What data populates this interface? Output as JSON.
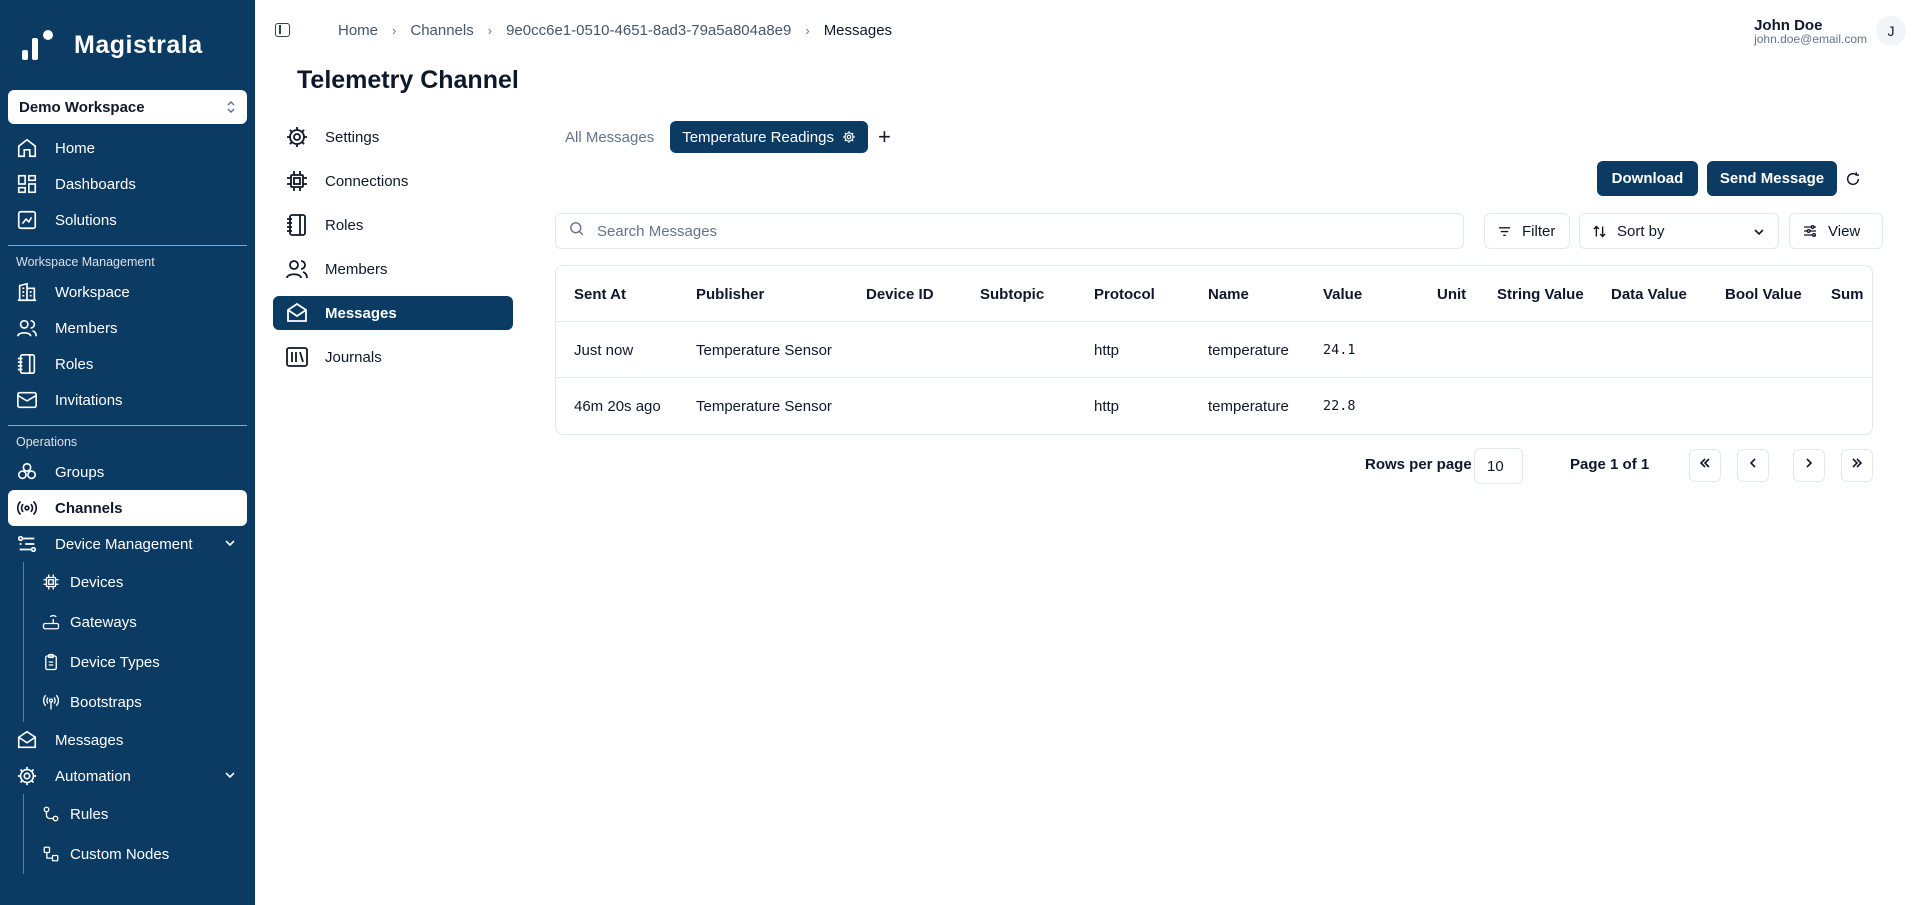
{
  "app": {
    "name": "Magistrala"
  },
  "workspace": {
    "selected": "Demo Workspace"
  },
  "sidebar": {
    "main": [
      {
        "label": "Home",
        "icon": "home-icon"
      },
      {
        "label": "Dashboards",
        "icon": "dashboard-icon"
      },
      {
        "label": "Solutions",
        "icon": "solutions-icon"
      }
    ],
    "workspace_section": "Workspace Management",
    "workspace_items": [
      {
        "label": "Workspace",
        "icon": "building-icon"
      },
      {
        "label": "Members",
        "icon": "users-icon"
      },
      {
        "label": "Roles",
        "icon": "notebook-icon"
      },
      {
        "label": "Invitations",
        "icon": "mail-icon"
      }
    ],
    "operations_section": "Operations",
    "operations_items": [
      {
        "label": "Groups",
        "icon": "groups-icon"
      },
      {
        "label": "Channels",
        "icon": "radio-icon",
        "active": true
      },
      {
        "label": "Device Management",
        "icon": "device-management-icon"
      }
    ],
    "device_sub": [
      {
        "label": "Devices",
        "icon": "cpu-icon"
      },
      {
        "label": "Gateways",
        "icon": "router-icon"
      },
      {
        "label": "Device Types",
        "icon": "clipboard-icon"
      },
      {
        "label": "Bootstraps",
        "icon": "signal-icon"
      }
    ],
    "messages": {
      "label": "Messages",
      "icon": "mail-open-icon"
    },
    "automation": {
      "label": "Automation",
      "icon": "gear-icon"
    },
    "automation_sub": [
      {
        "label": "Rules",
        "icon": "workflow-icon"
      },
      {
        "label": "Custom Nodes",
        "icon": "nodes-icon"
      }
    ]
  },
  "breadcrumb": [
    "Home",
    "Channels",
    "9e0cc6e1-0510-4651-8ad3-79a5a804a8e9",
    "Messages"
  ],
  "user": {
    "name": "John Doe",
    "email": "john.doe@email.com",
    "initial": "J"
  },
  "page": {
    "title": "Telemetry Channel"
  },
  "channel_menu": [
    {
      "label": "Settings",
      "icon": "settings-icon"
    },
    {
      "label": "Connections",
      "icon": "chip-icon"
    },
    {
      "label": "Roles",
      "icon": "notebook-icon"
    },
    {
      "label": "Members",
      "icon": "users-icon"
    },
    {
      "label": "Messages",
      "icon": "mail-open-icon",
      "active": true
    },
    {
      "label": "Journals",
      "icon": "library-icon"
    }
  ],
  "tabs": {
    "all": "All Messages",
    "active": "Temperature Readings",
    "add": "+"
  },
  "actions": {
    "download": "Download",
    "send": "Send Message"
  },
  "search": {
    "placeholder": "Search Messages",
    "value": ""
  },
  "toolbar": {
    "filter": "Filter",
    "sort": "Sort by",
    "view": "View"
  },
  "table": {
    "columns": [
      "Sent At",
      "Publisher",
      "Device ID",
      "Subtopic",
      "Protocol",
      "Name",
      "Value",
      "Unit",
      "String Value",
      "Data Value",
      "Bool Value",
      "Sum"
    ],
    "rows": [
      [
        "Just now",
        "Temperature Sensor",
        "",
        "",
        "http",
        "temperature",
        "24.1",
        "",
        "",
        "",
        "",
        ""
      ],
      [
        "46m 20s ago",
        "Temperature Sensor",
        "",
        "",
        "http",
        "temperature",
        "22.8",
        "",
        "",
        "",
        "",
        ""
      ]
    ]
  },
  "pagination": {
    "rows_label": "Rows per page",
    "rows_value": "10",
    "page_info": "Page 1 of 1"
  },
  "colors": {
    "brand": "#0b3a63",
    "border": "#e2e8f0",
    "muted": "#64748b"
  }
}
